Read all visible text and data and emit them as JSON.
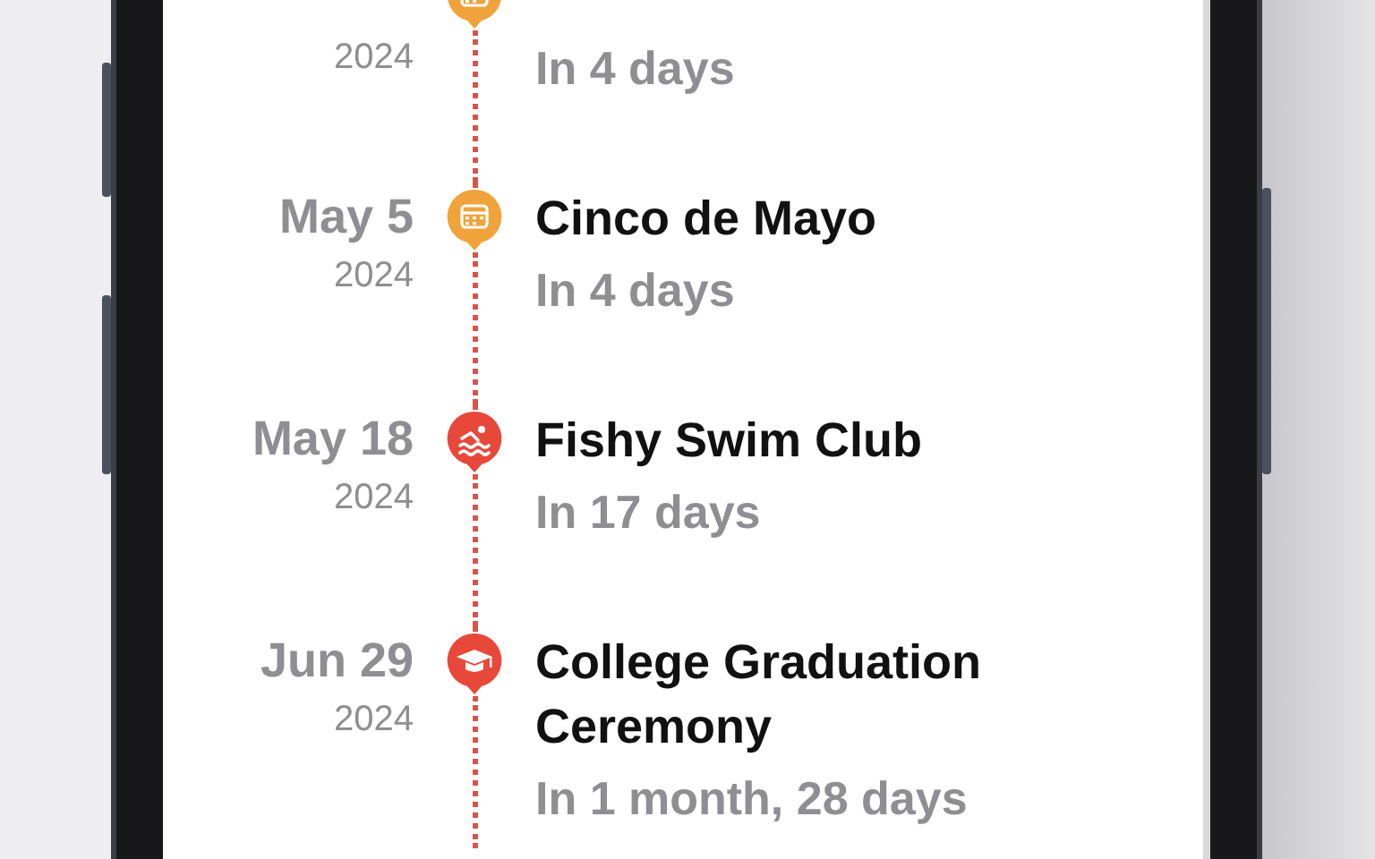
{
  "events": [
    {
      "year": "2024",
      "when": "In 4 days",
      "kind": "calendar",
      "color": "#f0a33a"
    },
    {
      "date": "May 5",
      "year": "2024",
      "title": "Cinco de Mayo",
      "when": "In 4 days",
      "kind": "calendar",
      "color": "#f0a33a"
    },
    {
      "date": "May 18",
      "year": "2024",
      "title": "Fishy Swim Club",
      "when": "In 17 days",
      "kind": "swim",
      "color": "#e8483a"
    },
    {
      "date": "Jun 29",
      "year": "2024",
      "title": "College Graduation Ceremony",
      "when": "In 1 month, 28 days",
      "kind": "graduation",
      "color": "#e8483a"
    }
  ]
}
